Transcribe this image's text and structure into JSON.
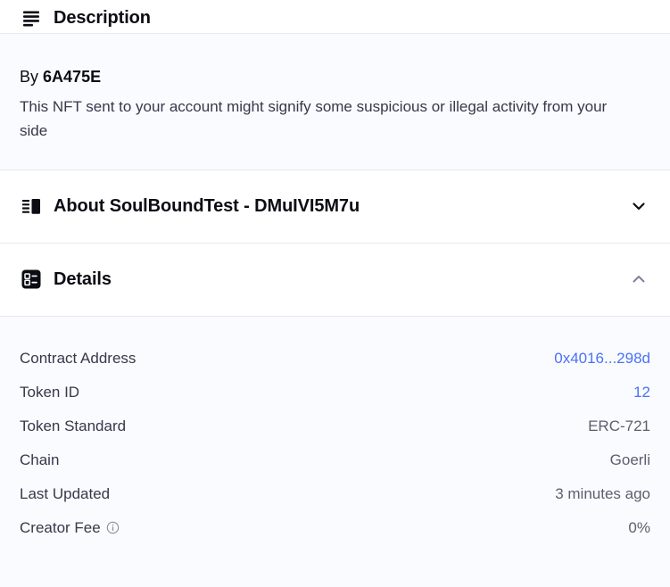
{
  "sections": {
    "description": {
      "title": "Description",
      "icon": "text-lines-icon",
      "by_label": "By",
      "by_name": "6A475E",
      "body_text": "This NFT sent to your account might signify some suspicious or illegal activity from your side"
    },
    "about": {
      "title": "About SoulBoundTest - DMuIVI5M7u",
      "icon": "collection-icon",
      "chevron": "chevron-down-icon",
      "expanded": false
    },
    "details": {
      "title": "Details",
      "icon": "details-list-icon",
      "chevron": "chevron-up-icon",
      "expanded": true,
      "rows": [
        {
          "label": "Contract Address",
          "value": "0x4016...298d",
          "is_link": true,
          "has_info": false
        },
        {
          "label": "Token ID",
          "value": "12",
          "is_link": true,
          "has_info": false
        },
        {
          "label": "Token Standard",
          "value": "ERC-721",
          "is_link": false,
          "has_info": false
        },
        {
          "label": "Chain",
          "value": "Goerli",
          "is_link": false,
          "has_info": false
        },
        {
          "label": "Last Updated",
          "value": "3 minutes ago",
          "is_link": false,
          "has_info": false
        },
        {
          "label": "Creator Fee",
          "value": "0%",
          "is_link": false,
          "has_info": true,
          "info_icon": "info-circle-icon"
        }
      ]
    }
  },
  "colors": {
    "link": "#4a72f5",
    "body_background": "#fafbfe",
    "header_background": "#ffffff",
    "divider": "#e6e8ec",
    "title_text": "#0c0d14",
    "muted_text": "#5b5f70"
  }
}
